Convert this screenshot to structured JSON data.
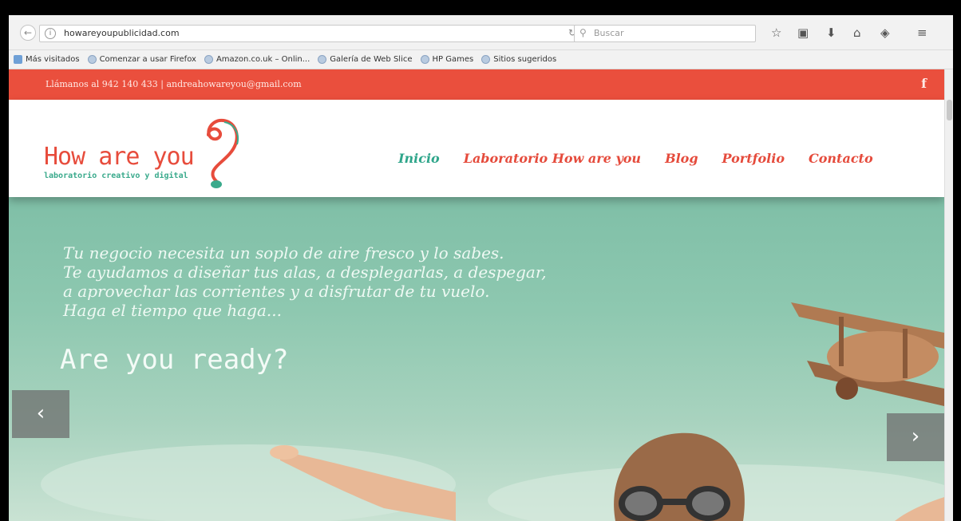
{
  "browser": {
    "url": "howareyoupublicidad.com",
    "search_placeholder": "Buscar",
    "bookmarks": [
      "Más visitados",
      "Comenzar a usar Firefox",
      "Amazon.co.uk – Onlin...",
      "Galería de Web Slice",
      "HP Games",
      "Sitios sugeridos"
    ]
  },
  "site": {
    "contact_bar": "Llámanos al 942 140 433  |  andreahowareyou@gmail.com",
    "facebook_label": "f",
    "logo_text": "How are you",
    "logo_sub": "laboratorio creativo y digital",
    "menu": [
      "Inicio",
      "Laboratorio How are you",
      "Blog",
      "Portfolio",
      "Contacto"
    ],
    "active_menu": "Inicio",
    "hero": {
      "lines": [
        "Tu negocio necesita un soplo de aire fresco y lo sabes.",
        "Te ayudamos a diseñar tus alas, a desplegarlas, a despegar,",
        "a aprovechar las corrientes y a disfrutar de tu vuelo.",
        "Haga el tiempo que haga..."
      ],
      "title": "Are you ready?",
      "prev_label": "‹",
      "next_label": "›"
    }
  },
  "colors": {
    "topbar": "#ea4f3d",
    "menu": "#e54b3c",
    "menu_active": "#2ea58a",
    "hero_sky": "#8ec8b0"
  }
}
